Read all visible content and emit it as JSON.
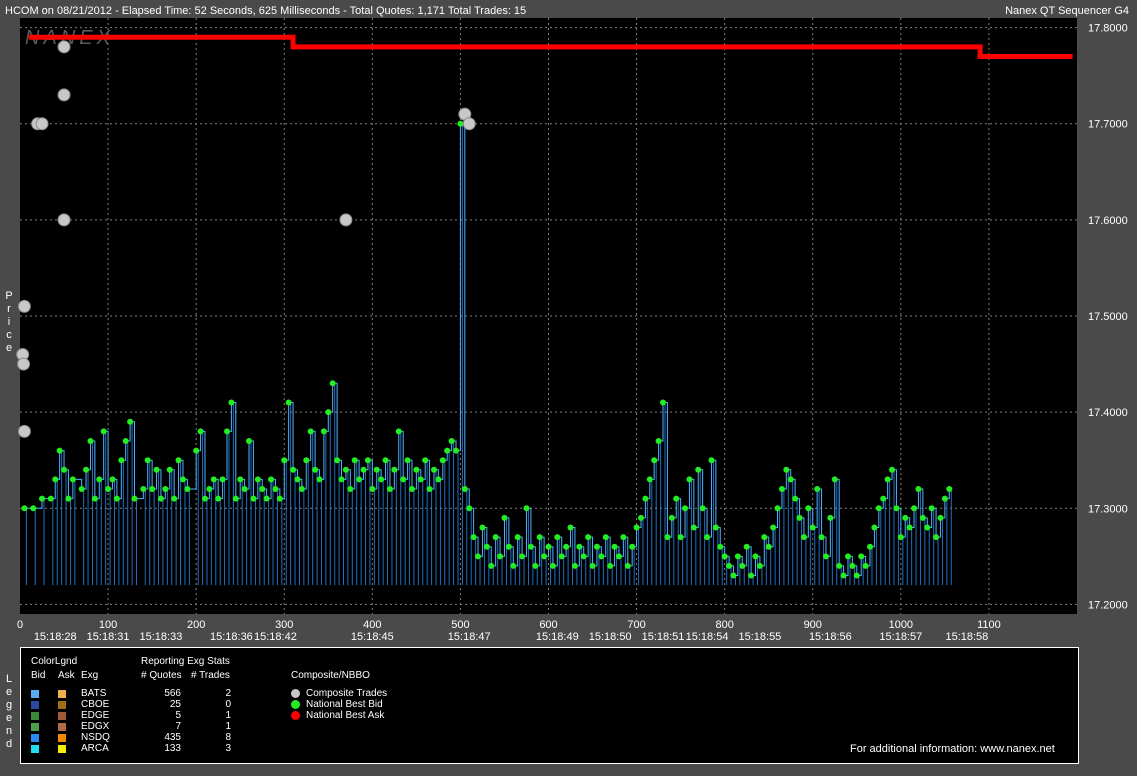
{
  "header": {
    "title": "HCOM on 08/21/2012  -  Elapsed Time: 52 Seconds, 625 Milliseconds  -  Total Quotes: 1,171  Total Trades: 15",
    "app_name": "Nanex QT Sequencer G4",
    "watermark": "NANEX"
  },
  "axis_labels": {
    "y": "Price",
    "legend_side": "Legend"
  },
  "colors": {
    "bid_line": "#4fb3ff",
    "nbb": "#22ee22",
    "nbo": "#ff0000",
    "trade": "#c8c8c8",
    "grid": "#808080",
    "plot_bg": "#000000",
    "frame_bg": "#4a4a4a"
  },
  "chart_data": {
    "type": "scatter",
    "title": "HCOM on 08/21/2012",
    "xlabel": "",
    "ylabel": "Price",
    "xlim": [
      0,
      1200
    ],
    "ylim": [
      17.19,
      17.81
    ],
    "grid": true,
    "x_ticks": [
      0,
      100,
      200,
      300,
      400,
      500,
      600,
      700,
      800,
      900,
      1000,
      1100
    ],
    "y_ticks": [
      "17.2000",
      "17.3000",
      "17.4000",
      "17.5000",
      "17.6000",
      "17.7000",
      "17.8000"
    ],
    "time_labels": [
      {
        "x": 40,
        "label": "15:18:28"
      },
      {
        "x": 100,
        "label": "15:18:31"
      },
      {
        "x": 160,
        "label": "15:18:33"
      },
      {
        "x": 240,
        "label": "15:18:36"
      },
      {
        "x": 290,
        "label": "15:18:42"
      },
      {
        "x": 400,
        "label": "15:18:45"
      },
      {
        "x": 510,
        "label": "15:18:47"
      },
      {
        "x": 610,
        "label": "15:18:49"
      },
      {
        "x": 670,
        "label": "15:18:50"
      },
      {
        "x": 730,
        "label": "15:18:51"
      },
      {
        "x": 780,
        "label": "15:18:54"
      },
      {
        "x": 840,
        "label": "15:18:55"
      },
      {
        "x": 920,
        "label": "15:18:56"
      },
      {
        "x": 1000,
        "label": "15:18:57"
      },
      {
        "x": 1075,
        "label": "15:18:58"
      }
    ],
    "series": [
      {
        "name": "National Best Ask",
        "points": [
          [
            10,
            17.79
          ],
          [
            100,
            17.79
          ],
          [
            200,
            17.79
          ],
          [
            305,
            17.79
          ],
          [
            310,
            17.78
          ],
          [
            500,
            17.78
          ],
          [
            700,
            17.78
          ],
          [
            900,
            17.78
          ],
          [
            1085,
            17.78
          ],
          [
            1090,
            17.77
          ],
          [
            1195,
            17.77
          ]
        ]
      },
      {
        "name": "National Best Bid",
        "points": [
          [
            5,
            17.3
          ],
          [
            15,
            17.3
          ],
          [
            25,
            17.31
          ],
          [
            35,
            17.31
          ],
          [
            40,
            17.33
          ],
          [
            45,
            17.36
          ],
          [
            50,
            17.34
          ],
          [
            55,
            17.31
          ],
          [
            60,
            17.33
          ],
          [
            70,
            17.32
          ],
          [
            75,
            17.34
          ],
          [
            80,
            17.37
          ],
          [
            85,
            17.31
          ],
          [
            90,
            17.33
          ],
          [
            95,
            17.38
          ],
          [
            100,
            17.32
          ],
          [
            105,
            17.33
          ],
          [
            110,
            17.31
          ],
          [
            115,
            17.35
          ],
          [
            120,
            17.37
          ],
          [
            125,
            17.39
          ],
          [
            130,
            17.31
          ],
          [
            140,
            17.32
          ],
          [
            145,
            17.35
          ],
          [
            150,
            17.32
          ],
          [
            155,
            17.34
          ],
          [
            160,
            17.31
          ],
          [
            165,
            17.32
          ],
          [
            170,
            17.34
          ],
          [
            175,
            17.31
          ],
          [
            180,
            17.35
          ],
          [
            185,
            17.33
          ],
          [
            190,
            17.32
          ],
          [
            200,
            17.36
          ],
          [
            205,
            17.38
          ],
          [
            210,
            17.31
          ],
          [
            215,
            17.32
          ],
          [
            220,
            17.33
          ],
          [
            225,
            17.31
          ],
          [
            230,
            17.33
          ],
          [
            235,
            17.38
          ],
          [
            240,
            17.41
          ],
          [
            245,
            17.31
          ],
          [
            250,
            17.33
          ],
          [
            255,
            17.32
          ],
          [
            260,
            17.37
          ],
          [
            265,
            17.31
          ],
          [
            270,
            17.33
          ],
          [
            275,
            17.32
          ],
          [
            280,
            17.31
          ],
          [
            285,
            17.33
          ],
          [
            290,
            17.32
          ],
          [
            295,
            17.31
          ],
          [
            300,
            17.35
          ],
          [
            305,
            17.41
          ],
          [
            310,
            17.34
          ],
          [
            315,
            17.33
          ],
          [
            320,
            17.32
          ],
          [
            325,
            17.35
          ],
          [
            330,
            17.38
          ],
          [
            335,
            17.34
          ],
          [
            340,
            17.33
          ],
          [
            345,
            17.38
          ],
          [
            350,
            17.4
          ],
          [
            355,
            17.43
          ],
          [
            360,
            17.35
          ],
          [
            365,
            17.33
          ],
          [
            370,
            17.34
          ],
          [
            375,
            17.32
          ],
          [
            380,
            17.35
          ],
          [
            385,
            17.33
          ],
          [
            390,
            17.34
          ],
          [
            395,
            17.35
          ],
          [
            400,
            17.32
          ],
          [
            405,
            17.34
          ],
          [
            410,
            17.33
          ],
          [
            415,
            17.35
          ],
          [
            420,
            17.32
          ],
          [
            425,
            17.34
          ],
          [
            430,
            17.38
          ],
          [
            435,
            17.33
          ],
          [
            440,
            17.35
          ],
          [
            445,
            17.32
          ],
          [
            450,
            17.34
          ],
          [
            455,
            17.33
          ],
          [
            460,
            17.35
          ],
          [
            465,
            17.32
          ],
          [
            470,
            17.34
          ],
          [
            475,
            17.33
          ],
          [
            480,
            17.35
          ],
          [
            485,
            17.36
          ],
          [
            490,
            17.37
          ],
          [
            495,
            17.36
          ],
          [
            500,
            17.7
          ],
          [
            505,
            17.32
          ],
          [
            510,
            17.3
          ],
          [
            515,
            17.27
          ],
          [
            520,
            17.25
          ],
          [
            525,
            17.28
          ],
          [
            530,
            17.26
          ],
          [
            535,
            17.24
          ],
          [
            540,
            17.27
          ],
          [
            545,
            17.25
          ],
          [
            550,
            17.29
          ],
          [
            555,
            17.26
          ],
          [
            560,
            17.24
          ],
          [
            565,
            17.27
          ],
          [
            570,
            17.25
          ],
          [
            575,
            17.3
          ],
          [
            580,
            17.26
          ],
          [
            585,
            17.24
          ],
          [
            590,
            17.27
          ],
          [
            595,
            17.25
          ],
          [
            600,
            17.26
          ],
          [
            605,
            17.24
          ],
          [
            610,
            17.27
          ],
          [
            615,
            17.25
          ],
          [
            620,
            17.26
          ],
          [
            625,
            17.28
          ],
          [
            630,
            17.24
          ],
          [
            635,
            17.26
          ],
          [
            640,
            17.25
          ],
          [
            645,
            17.27
          ],
          [
            650,
            17.24
          ],
          [
            655,
            17.26
          ],
          [
            660,
            17.25
          ],
          [
            665,
            17.27
          ],
          [
            670,
            17.24
          ],
          [
            675,
            17.26
          ],
          [
            680,
            17.25
          ],
          [
            685,
            17.27
          ],
          [
            690,
            17.24
          ],
          [
            695,
            17.26
          ],
          [
            700,
            17.28
          ],
          [
            705,
            17.29
          ],
          [
            710,
            17.31
          ],
          [
            715,
            17.33
          ],
          [
            720,
            17.35
          ],
          [
            725,
            17.37
          ],
          [
            730,
            17.41
          ],
          [
            735,
            17.27
          ],
          [
            740,
            17.29
          ],
          [
            745,
            17.31
          ],
          [
            750,
            17.27
          ],
          [
            755,
            17.3
          ],
          [
            760,
            17.33
          ],
          [
            765,
            17.28
          ],
          [
            770,
            17.34
          ],
          [
            775,
            17.3
          ],
          [
            780,
            17.27
          ],
          [
            785,
            17.35
          ],
          [
            790,
            17.28
          ],
          [
            795,
            17.26
          ],
          [
            800,
            17.25
          ],
          [
            805,
            17.24
          ],
          [
            810,
            17.23
          ],
          [
            815,
            17.25
          ],
          [
            820,
            17.24
          ],
          [
            825,
            17.26
          ],
          [
            830,
            17.23
          ],
          [
            835,
            17.25
          ],
          [
            840,
            17.24
          ],
          [
            845,
            17.27
          ],
          [
            850,
            17.26
          ],
          [
            855,
            17.28
          ],
          [
            860,
            17.3
          ],
          [
            865,
            17.32
          ],
          [
            870,
            17.34
          ],
          [
            875,
            17.33
          ],
          [
            880,
            17.31
          ],
          [
            885,
            17.29
          ],
          [
            890,
            17.27
          ],
          [
            895,
            17.3
          ],
          [
            900,
            17.28
          ],
          [
            905,
            17.32
          ],
          [
            910,
            17.27
          ],
          [
            915,
            17.25
          ],
          [
            920,
            17.29
          ],
          [
            925,
            17.33
          ],
          [
            930,
            17.24
          ],
          [
            935,
            17.23
          ],
          [
            940,
            17.25
          ],
          [
            945,
            17.24
          ],
          [
            950,
            17.23
          ],
          [
            955,
            17.25
          ],
          [
            960,
            17.24
          ],
          [
            965,
            17.26
          ],
          [
            970,
            17.28
          ],
          [
            975,
            17.3
          ],
          [
            980,
            17.31
          ],
          [
            985,
            17.33
          ],
          [
            990,
            17.34
          ],
          [
            995,
            17.3
          ],
          [
            1000,
            17.27
          ],
          [
            1005,
            17.29
          ],
          [
            1010,
            17.28
          ],
          [
            1015,
            17.3
          ],
          [
            1020,
            17.32
          ],
          [
            1025,
            17.29
          ],
          [
            1030,
            17.28
          ],
          [
            1035,
            17.3
          ],
          [
            1040,
            17.27
          ],
          [
            1045,
            17.29
          ],
          [
            1050,
            17.31
          ],
          [
            1055,
            17.32
          ]
        ]
      },
      {
        "name": "Composite Trades",
        "points": [
          [
            5,
            17.51
          ],
          [
            3,
            17.46
          ],
          [
            4,
            17.45
          ],
          [
            5,
            17.38
          ],
          [
            20,
            17.7
          ],
          [
            25,
            17.7
          ],
          [
            50,
            17.78
          ],
          [
            50,
            17.73
          ],
          [
            50,
            17.6
          ],
          [
            370,
            17.6
          ],
          [
            505,
            17.71
          ],
          [
            510,
            17.7
          ]
        ]
      }
    ]
  },
  "legend": {
    "heading_color": "ColorLgnd",
    "col_bid": "Bid",
    "col_ask": "Ask",
    "col_exg": "Exg",
    "heading_stats": "Reporting Exg Stats",
    "col_quotes": "# Quotes",
    "col_trades": "# Trades",
    "heading_composite": "Composite/NBBO",
    "exchanges": [
      {
        "name": "BATS",
        "quotes": "566",
        "trades": "2",
        "bid_color": "#5aaaf0",
        "ask_color": "#f0b050"
      },
      {
        "name": "CBOE",
        "quotes": "25",
        "trades": "0",
        "bid_color": "#2a4aa0",
        "ask_color": "#a07010"
      },
      {
        "name": "EDGE",
        "quotes": "5",
        "trades": "1",
        "bid_color": "#3a8a3a",
        "ask_color": "#a05a3a"
      },
      {
        "name": "EDGX",
        "quotes": "7",
        "trades": "1",
        "bid_color": "#4aa04a",
        "ask_color": "#b06a4a"
      },
      {
        "name": "NSDQ",
        "quotes": "435",
        "trades": "8",
        "bid_color": "#2a8af0",
        "ask_color": "#f08a00"
      },
      {
        "name": "ARCA",
        "quotes": "133",
        "trades": "3",
        "bid_color": "#20e0f0",
        "ask_color": "#f0f000"
      }
    ],
    "composite_items": [
      {
        "label": "Composite Trades",
        "color": "#c8c8c8"
      },
      {
        "label": "National Best Bid",
        "color": "#22ee22"
      },
      {
        "label": "National Best Ask",
        "color": "#ff0000"
      }
    ],
    "footer": "For additional information: www.nanex.net"
  }
}
